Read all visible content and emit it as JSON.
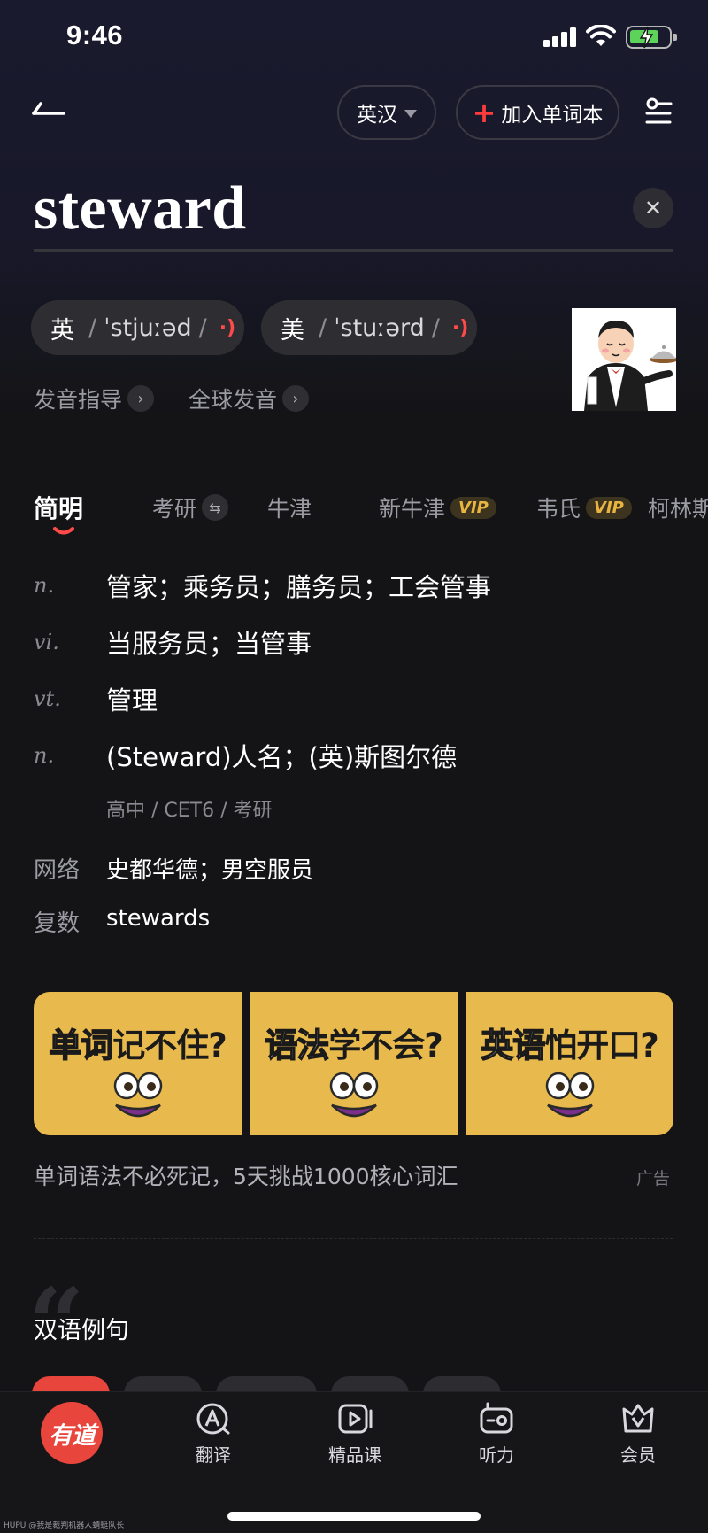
{
  "status_bar": {
    "time": "9:46"
  },
  "header": {
    "lang_selector": "英汉",
    "add_wordbook": "加入单词本"
  },
  "word": "steward",
  "pronunciation": {
    "uk_label": "英",
    "uk_ipa": "ˈstjuːəd",
    "us_label": "美",
    "us_ipa": "ˈstuːərd",
    "guide": "发音指导",
    "global": "全球发音"
  },
  "tabs": [
    {
      "label": "简明",
      "active": true
    },
    {
      "label": "考研"
    },
    {
      "label": "牛津"
    },
    {
      "label": "新牛津",
      "badge": "VIP"
    },
    {
      "label": "韦氏",
      "badge": "VIP"
    },
    {
      "label": "柯林斯"
    }
  ],
  "definitions": [
    {
      "pos": "n.",
      "text": "管家；乘务员；膳务员；工会管事"
    },
    {
      "pos": "vi.",
      "text": "当服务员；当管事"
    },
    {
      "pos": "vt.",
      "text": "管理"
    },
    {
      "pos": "n.",
      "text": "(Steward)人名；(英)斯图尔德"
    }
  ],
  "exam_tags": "高中 / CET6 / 考研",
  "extra": [
    {
      "label": "网络",
      "value": "史都华德；男空服员"
    },
    {
      "label": "复数",
      "value": "stewards"
    }
  ],
  "ad": {
    "cards": [
      {
        "a": "单词",
        "b": "记不住?"
      },
      {
        "a": "语法",
        "b": "学不会?"
      },
      {
        "a": "英语",
        "b": "怕开口?"
      }
    ],
    "caption": "单词语法不必死记，5天挑战1000核心词汇",
    "label": "广告"
  },
  "examples": {
    "title": "双语例句"
  },
  "bottom_nav": {
    "logo": "有道",
    "items": [
      "翻译",
      "精品课",
      "听力",
      "会员"
    ]
  },
  "watermark": "HUPU @我是裁判机器人蜻蜓队长",
  "colors": {
    "accent": "#ff4a4a",
    "vip": "#e9b43f",
    "ad_bg": "#e8b94d",
    "logo_bg": "#e8453c"
  }
}
